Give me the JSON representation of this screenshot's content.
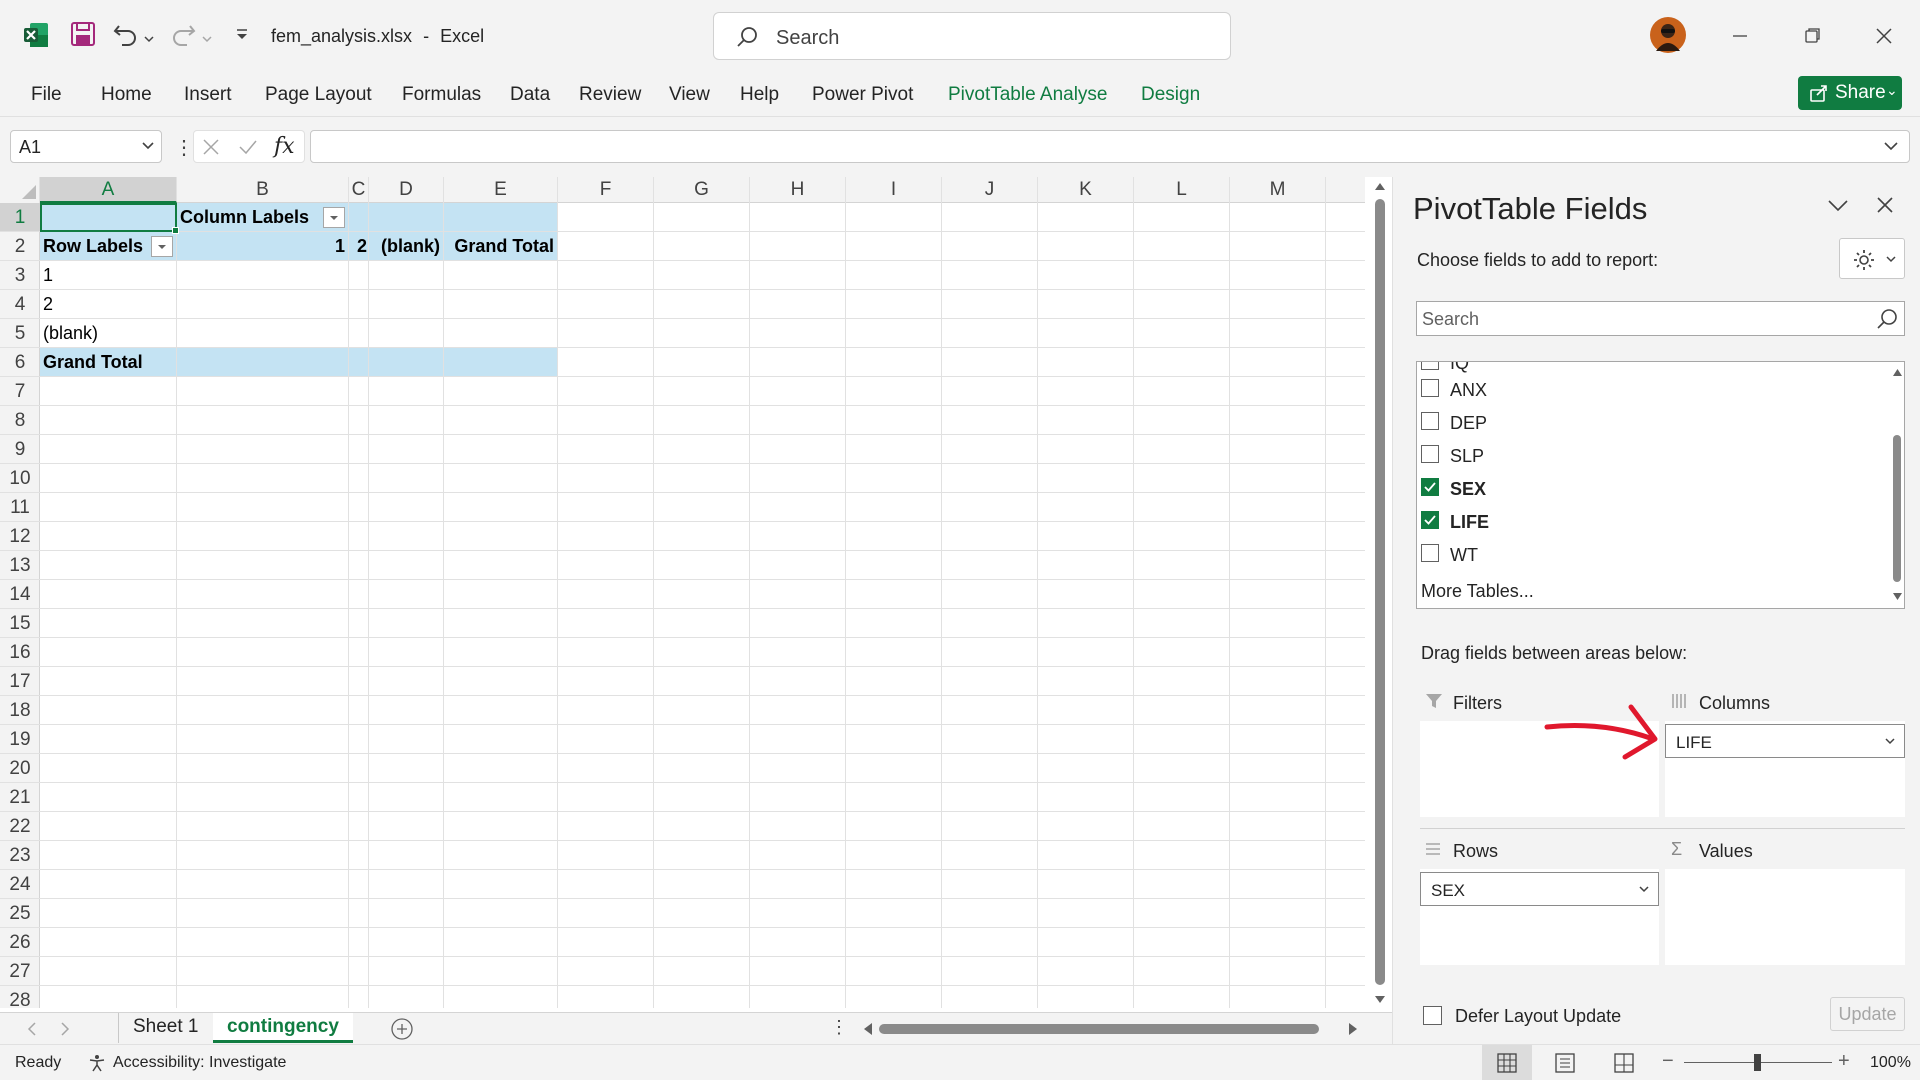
{
  "app": {
    "file_name": "fem_analysis.xlsx",
    "separator": "-",
    "app_name": "Excel",
    "search_placeholder": "Search"
  },
  "ribbon": {
    "tabs": [
      "File",
      "Home",
      "Insert",
      "Page Layout",
      "Formulas",
      "Data",
      "Review",
      "View",
      "Help",
      "Power Pivot",
      "PivotTable Analyse",
      "Design"
    ],
    "share_label": "Share"
  },
  "formula_bar": {
    "name_box": "A1",
    "formula": ""
  },
  "grid": {
    "columns": [
      "A",
      "B",
      "C",
      "D",
      "E",
      "F",
      "G",
      "H",
      "I",
      "J",
      "K",
      "L",
      "M"
    ],
    "rows": [
      "1",
      "2",
      "3",
      "4",
      "5",
      "6",
      "7",
      "8",
      "9",
      "10",
      "11",
      "12",
      "13",
      "14",
      "15",
      "16",
      "17",
      "18",
      "19",
      "20",
      "21",
      "22",
      "23",
      "24",
      "25",
      "26",
      "27",
      "28"
    ],
    "cells": {
      "b1": "Column Labels",
      "a2": "Row Labels",
      "b2": "1",
      "c2": "2",
      "d2": "(blank)",
      "e2": "Grand Total",
      "a3": "1",
      "a4": "2",
      "a5": "(blank)",
      "a6": "Grand Total"
    }
  },
  "sheets": {
    "tabs": [
      "Sheet 1",
      "contingency"
    ],
    "active": "contingency"
  },
  "status": {
    "ready": "Ready",
    "accessibility": "Accessibility: Investigate",
    "zoom": "100%"
  },
  "pivot_pane": {
    "title": "PivotTable Fields",
    "subtitle": "Choose fields to add to report:",
    "search_placeholder": "Search",
    "partial_field": "IQ",
    "fields": [
      {
        "name": "ANX",
        "checked": false
      },
      {
        "name": "DEP",
        "checked": false
      },
      {
        "name": "SLP",
        "checked": false
      },
      {
        "name": "SEX",
        "checked": true
      },
      {
        "name": "LIFE",
        "checked": true
      },
      {
        "name": "WT",
        "checked": false
      }
    ],
    "more_tables": "More Tables...",
    "drag_label": "Drag fields between areas below:",
    "areas": {
      "filters": "Filters",
      "columns": "Columns",
      "rows": "Rows",
      "values": "Values",
      "columns_field": "LIFE",
      "rows_field": "SEX"
    },
    "defer_label": "Defer Layout Update",
    "update_label": "Update"
  },
  "colors": {
    "accent": "#107c41",
    "pivot_header": "#c4e3f3",
    "annotation_arrow": "#e0182d"
  }
}
